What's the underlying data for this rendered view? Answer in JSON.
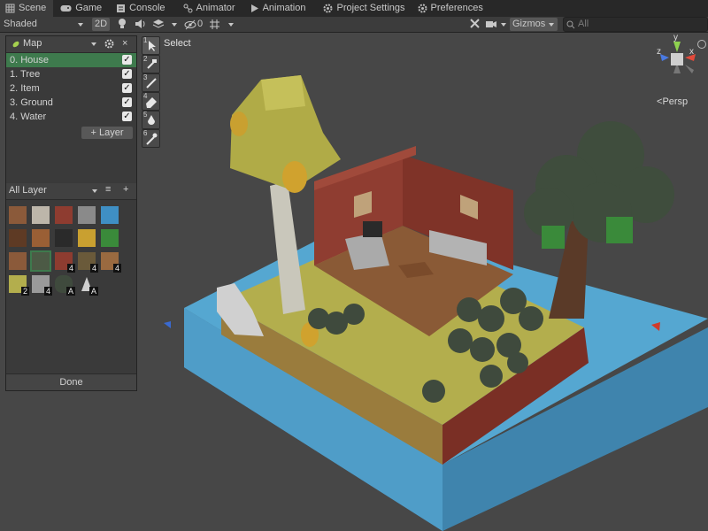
{
  "tabs": [
    {
      "label": "Scene",
      "icon": "grid-icon"
    },
    {
      "label": "Game",
      "icon": "gamepad-icon"
    },
    {
      "label": "Console",
      "icon": "console-icon"
    },
    {
      "label": "Animator",
      "icon": "animator-icon"
    },
    {
      "label": "Animation",
      "icon": "animation-icon"
    },
    {
      "label": "Project Settings",
      "icon": "gear-icon"
    },
    {
      "label": "Preferences",
      "icon": "gear-icon"
    }
  ],
  "toolbar": {
    "shading": "Shaded",
    "mode_2d": "2D",
    "hidden_count": "0",
    "gizmos": "Gizmos",
    "search_placeholder": "All"
  },
  "gizmo": {
    "persp": "Persp",
    "y": "y",
    "x": "x",
    "z": "z"
  },
  "panel": {
    "title": "Map",
    "layers": [
      {
        "label": "0.  House",
        "checked": true
      },
      {
        "label": "1.  Tree",
        "checked": true
      },
      {
        "label": "2.  Item",
        "checked": true
      },
      {
        "label": "3.  Ground",
        "checked": true
      },
      {
        "label": "4.  Water",
        "checked": true
      }
    ],
    "add_layer": "+ Layer",
    "filter": "All Layer",
    "palette_badges": [
      "4",
      "4",
      "4",
      "2",
      "4",
      "A",
      "A"
    ],
    "done": "Done"
  },
  "tools": {
    "select_label": "Select",
    "numbers": [
      "1",
      "2",
      "3",
      "4",
      "5",
      "6"
    ]
  },
  "colors": {
    "selected_row": "#3e7a4d",
    "bg": "#474747",
    "water": "#4a9cc4",
    "grass": "#b5b04e",
    "brick": "#8e3c30"
  }
}
